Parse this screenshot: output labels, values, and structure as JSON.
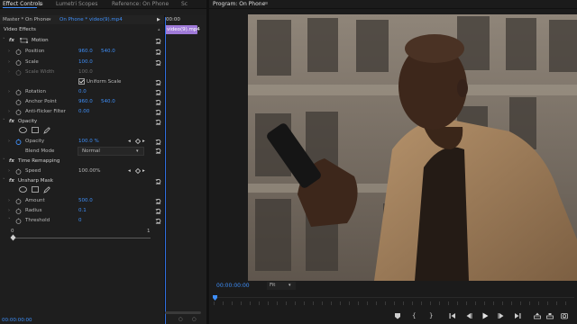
{
  "left_panel": {
    "tabs": [
      "Effect Controls",
      "Lumetri Scopes",
      "Reference: On Phone",
      "Sc"
    ],
    "menu_glyph": "≡",
    "clip_master": "Master * On Phone",
    "clip_active": "On Phone * video(9).mp4",
    "timeline_time": "00:00",
    "timeline_clip": "video(9).mp4",
    "video_effects_label": "Video Effects",
    "motion": {
      "label": "Motion",
      "position_label": "Position",
      "position_x": "960.0",
      "position_y": "540.0",
      "scale_label": "Scale",
      "scale_value": "100.0",
      "scale_width_label": "Scale Width",
      "scale_width_value": "100.0",
      "uniform_scale_label": "Uniform Scale",
      "rotation_label": "Rotation",
      "rotation_value": "0.0",
      "anchor_label": "Anchor Point",
      "anchor_x": "960.0",
      "anchor_y": "540.0",
      "antiflicker_label": "Anti-flicker Filter",
      "antiflicker_value": "0.00"
    },
    "opacity": {
      "label": "Opacity",
      "opacity_label": "Opacity",
      "opacity_value": "100.0 %",
      "blend_label": "Blend Mode",
      "blend_value": "Normal"
    },
    "time_remap": {
      "label": "Time Remapping",
      "speed_label": "Speed",
      "speed_value": "100.00%"
    },
    "unsharp": {
      "label": "Unsharp Mask",
      "amount_label": "Amount",
      "amount_value": "500.0",
      "radius_label": "Radius",
      "radius_value": "0.1",
      "threshold_label": "Threshold",
      "threshold_value": "0",
      "slider_min": "0",
      "slider_max": "1"
    },
    "footer_time": "00:00:00:00"
  },
  "program": {
    "tab": "Program: On Phone",
    "timecode": "00:00:00:00",
    "fit": "Fit"
  },
  "colors": {
    "accent": "#3e8ef7",
    "clip_purple": "#9f7ad8"
  }
}
